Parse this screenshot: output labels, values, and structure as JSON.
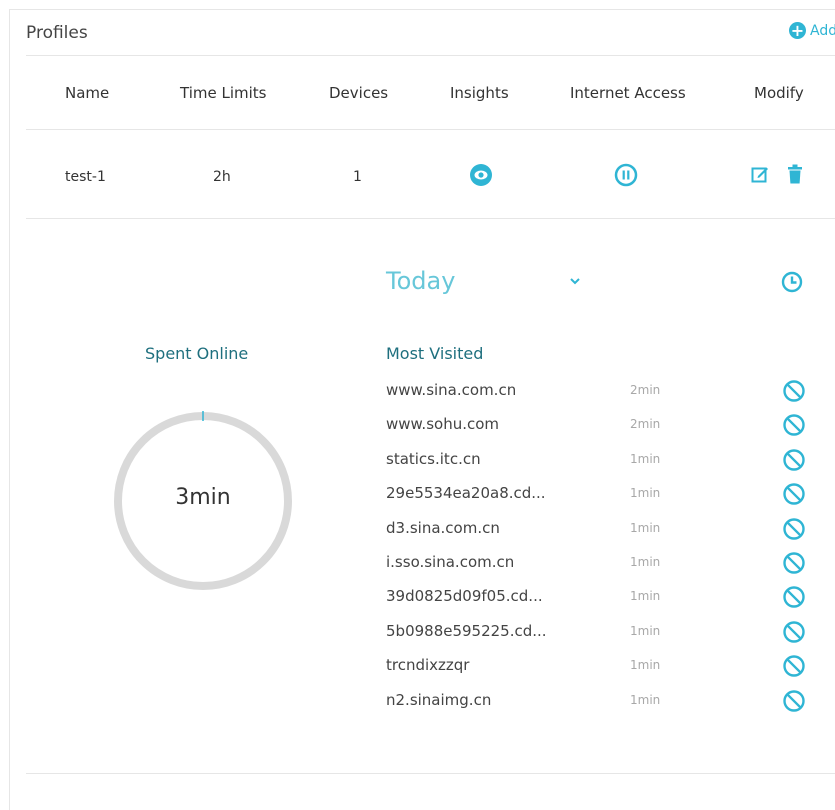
{
  "header": {
    "title": "Profiles",
    "add_label": "Add"
  },
  "table": {
    "columns": [
      "Name",
      "Time Limits",
      "Devices",
      "Insights",
      "Internet Access",
      "Modify"
    ],
    "row": {
      "name": "test-1",
      "time_limit": "2h",
      "devices": "1"
    }
  },
  "insights": {
    "period": "Today",
    "spent_label": "Spent Online",
    "spent_value": "3min",
    "most_visited_label": "Most Visited",
    "sites": [
      {
        "name": "www.sina.com.cn",
        "time": "2min"
      },
      {
        "name": "www.sohu.com",
        "time": "2min"
      },
      {
        "name": "statics.itc.cn",
        "time": "1min"
      },
      {
        "name": "29e5534ea20a8.cd...",
        "time": "1min"
      },
      {
        "name": "d3.sina.com.cn",
        "time": "1min"
      },
      {
        "name": "i.sso.sina.com.cn",
        "time": "1min"
      },
      {
        "name": "39d0825d09f05.cd...",
        "time": "1min"
      },
      {
        "name": "5b0988e595225.cd...",
        "time": "1min"
      },
      {
        "name": "trcndixzzqr",
        "time": "1min"
      },
      {
        "name": "n2.sinaimg.cn",
        "time": "1min"
      }
    ]
  },
  "icons": {
    "add": "plus-circle-icon",
    "insights": "eye-icon",
    "internet_access": "pause-icon",
    "edit": "edit-icon",
    "delete": "trash-icon",
    "period": "chevron-down-icon",
    "history": "clock-icon",
    "block": "block-icon"
  },
  "colors": {
    "accent": "#2fb5d4",
    "heading": "#1e6f7e",
    "ring": "#d9d9d9"
  }
}
